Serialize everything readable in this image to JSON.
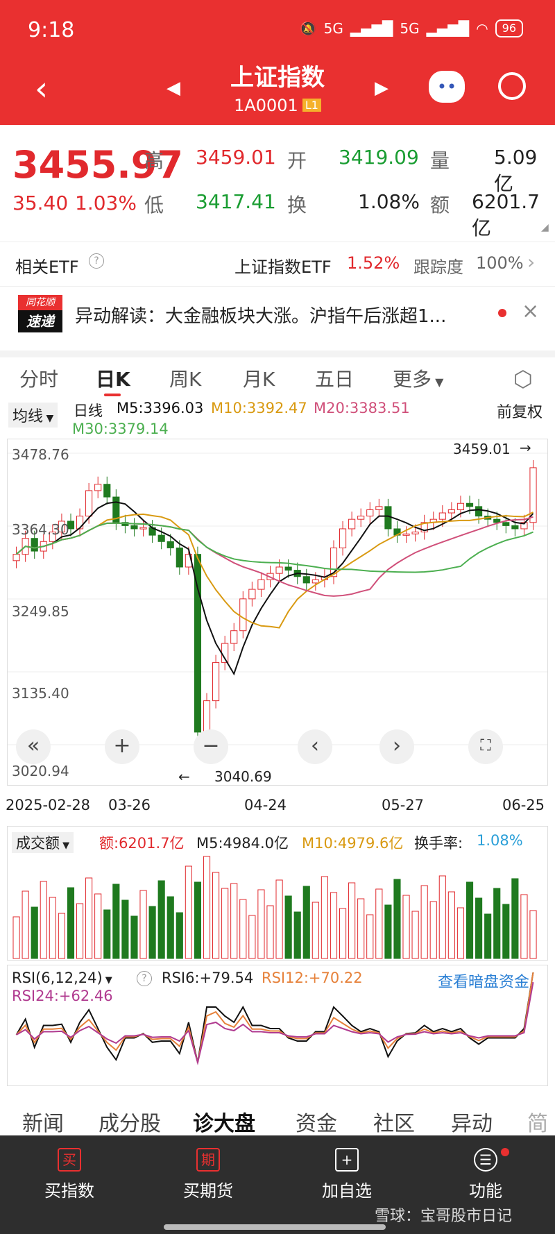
{
  "status": {
    "time": "9:18",
    "signal1": "5G",
    "signal2": "5G",
    "battery": "96"
  },
  "header": {
    "title": "上证指数",
    "code": "1A0001",
    "level": "L1"
  },
  "quote": {
    "price": "3455.97",
    "change": "35.40",
    "change_pct": "1.03%",
    "high_label": "高",
    "high": "3459.01",
    "low_label": "低",
    "low": "3417.41",
    "open_label": "开",
    "open": "3419.09",
    "turn_label": "换",
    "turnover": "1.08%",
    "vol_label": "量",
    "volume": "5.09亿",
    "amt_label": "额",
    "amount": "6201.7亿"
  },
  "etf": {
    "label": "相关ETF",
    "name": "上证指数ETF",
    "pct": "1.52%",
    "track_label": "跟踪度",
    "track": "100%"
  },
  "news": {
    "brand_top": "同花顺",
    "brand_bottom": "速递",
    "text": "异动解读：大金融板块大涨。沪指午后涨超1..."
  },
  "tabs": [
    "分时",
    "日K",
    "周K",
    "月K",
    "五日",
    "更多"
  ],
  "ma": {
    "selector": "均线",
    "period": "日线",
    "m5": "M5:3396.03",
    "m10": "M10:3392.47",
    "m20": "M20:3383.51",
    "m30": "M30:3379.14",
    "adjust": "前复权"
  },
  "chart_axis": {
    "y_ticks": [
      "3478.76",
      "3364.30",
      "3249.85",
      "3135.40",
      "3020.94"
    ],
    "x_ticks": [
      "2025-02-28",
      "03-26",
      "04-24",
      "05-27",
      "06-25"
    ],
    "high_mark": "3459.01",
    "low_mark": "3040.69"
  },
  "volume_panel": {
    "selector": "成交额",
    "amount": "额:6201.7亿",
    "m5": "M5:4984.0亿",
    "m10": "M10:4979.6亿",
    "turn_label": "换手率:",
    "turn": "1.08%"
  },
  "rsi_panel": {
    "selector": "RSI(6,12,24)",
    "rsi6": "RSI6:+79.54",
    "rsi12": "RSI12:+70.22",
    "rsi24": "RSI24:+62.46",
    "link": "查看暗盘资金"
  },
  "bottom_tabs": [
    "新闻",
    "成分股",
    "诊大盘",
    "资金",
    "社区",
    "异动",
    "简"
  ],
  "bottom_bar": [
    {
      "icon": "买",
      "label": "买指数"
    },
    {
      "icon": "期",
      "label": "买期货"
    },
    {
      "icon": "+",
      "label": "加自选"
    },
    {
      "icon": "☰",
      "label": "功能"
    }
  ],
  "watermark": "雪球：宝哥股市日记",
  "chart_data": {
    "type": "candlestick",
    "ylim": [
      3020.94,
      3478.76
    ],
    "x": [
      "2025-02-28",
      "03-26",
      "04-24",
      "05-27",
      "06-25"
    ],
    "close": [
      3320,
      3345,
      3325,
      3340,
      3355,
      3372,
      3360,
      3380,
      3420,
      3430,
      3410,
      3370,
      3365,
      3360,
      3362,
      3350,
      3340,
      3330,
      3300,
      3320,
      3040.69,
      3090,
      3150,
      3180,
      3200,
      3250,
      3265,
      3280,
      3290,
      3300,
      3295,
      3285,
      3275,
      3280,
      3285,
      3330,
      3360,
      3375,
      3380,
      3390,
      3395,
      3360,
      3350,
      3352,
      3355,
      3370,
      3375,
      3385,
      3390,
      3400,
      3395,
      3380,
      3375,
      3370,
      3365,
      3360,
      3370,
      3455.97
    ],
    "ma5": "3396.03",
    "ma10": "3392.47",
    "ma20": "3383.51",
    "ma30": "3379.14"
  }
}
